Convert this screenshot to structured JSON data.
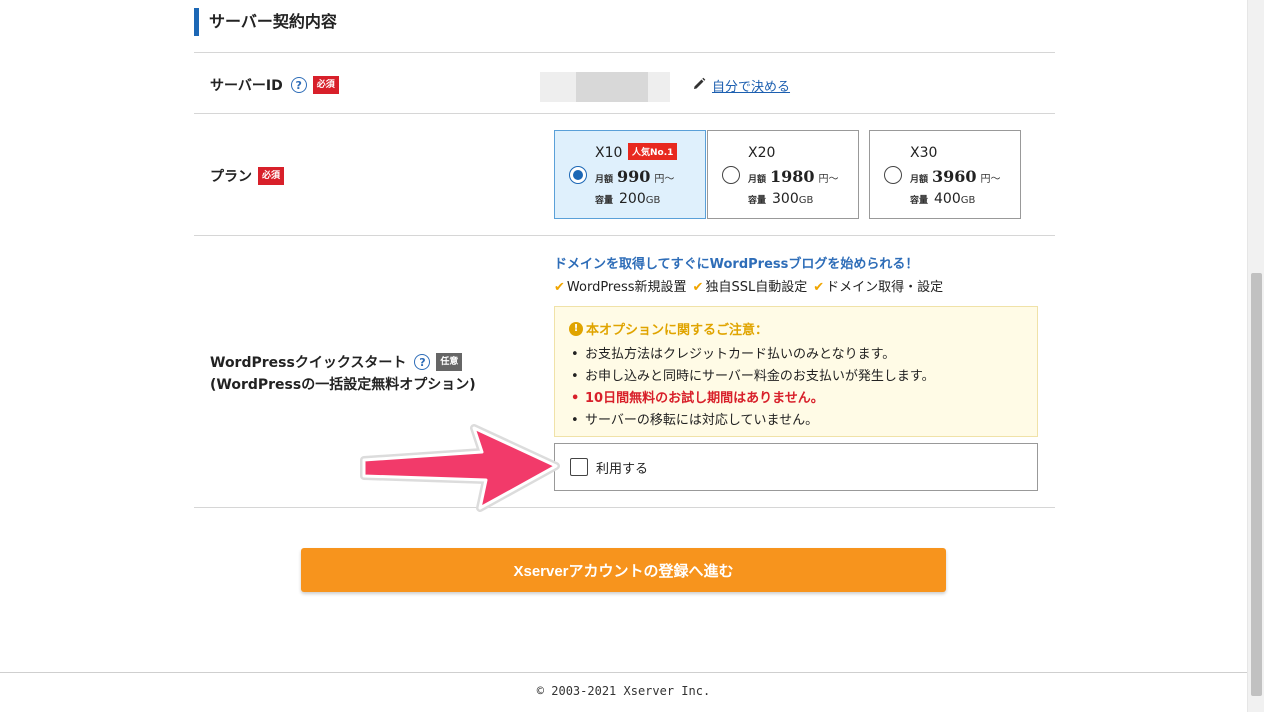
{
  "section": {
    "title": "サーバー契約内容"
  },
  "server_id": {
    "label": "サーバーID",
    "help": "?",
    "required_tag": "必須",
    "self_decide_link": "自分で決める"
  },
  "plan": {
    "label": "プラン",
    "required_tag": "必須",
    "selected": "X10",
    "options": [
      {
        "name": "X10",
        "badge": "人気No.1",
        "monthly_label": "月額",
        "price": "990",
        "price_unit": "円〜",
        "capacity_label": "容量",
        "capacity": "200",
        "capacity_unit": "GB"
      },
      {
        "name": "X20",
        "badge": "",
        "monthly_label": "月額",
        "price": "1980",
        "price_unit": "円〜",
        "capacity_label": "容量",
        "capacity": "300",
        "capacity_unit": "GB"
      },
      {
        "name": "X30",
        "badge": "",
        "monthly_label": "月額",
        "price": "3960",
        "price_unit": "円〜",
        "capacity_label": "容量",
        "capacity": "400",
        "capacity_unit": "GB"
      }
    ]
  },
  "wordpress": {
    "label": "WordPressクイックスタート",
    "sublabel": "(WordPressの一括設定無料オプション)",
    "help": "?",
    "optional_tag": "任意",
    "headline": "ドメインを取得してすぐにWordPressブログを始められる！",
    "features": [
      "WordPress新規設置",
      "独自SSL自動設定",
      "ドメイン取得・設定"
    ],
    "notice_title": "本オプションに関するご注意：",
    "notice_items": [
      "お支払方法はクレジットカード払いのみとなります。",
      "お申し込みと同時にサーバー料金のお支払いが発生します。",
      "10日間無料のお試し期間はありません。",
      "サーバーの移転には対応していません。"
    ],
    "use_label": "利用する",
    "use_checked": false
  },
  "submit": {
    "label": "Xserverアカウントの登録へ進む"
  },
  "footer": {
    "copyright": "© 2003-2021 Xserver Inc."
  },
  "colors": {
    "accent": "#1c67b5",
    "required": "#d8202a",
    "submit": "#f7941d",
    "arrow": "#f23a6a"
  }
}
